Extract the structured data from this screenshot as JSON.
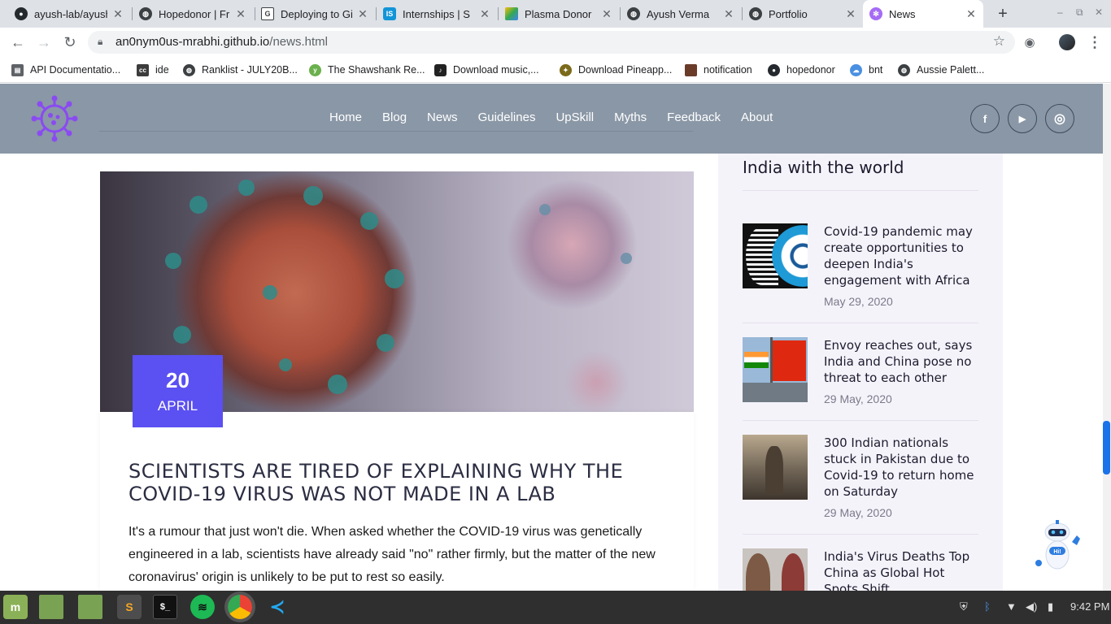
{
  "browser": {
    "tabs": [
      {
        "title": "ayush-lab/ayush",
        "icon": "github-icon",
        "active": false
      },
      {
        "title": "Hopedonor | Fr",
        "icon": "globe-icon",
        "active": false
      },
      {
        "title": "Deploying to Gi",
        "icon": "doc-icon",
        "active": false
      },
      {
        "title": "Internships | S",
        "icon": "internshala-icon",
        "active": false
      },
      {
        "title": "Plasma Donor",
        "icon": "drive-icon",
        "active": false
      },
      {
        "title": "Ayush Verma",
        "icon": "globe-icon",
        "active": false
      },
      {
        "title": "Portfolio",
        "icon": "globe-icon",
        "active": false
      },
      {
        "title": "News",
        "icon": "virus-icon",
        "active": true
      }
    ],
    "url_host": "an0nym0us-mrabhi.github.io",
    "url_path": "/news.html",
    "bookmarks": [
      {
        "label": "API Documentatio...",
        "icon": "doc-icon"
      },
      {
        "label": "ide",
        "icon": "cc-icon"
      },
      {
        "label": "Ranklist - JULY20B...",
        "icon": "globe-icon"
      },
      {
        "label": "The Shawshank Re...",
        "icon": "yts-icon"
      },
      {
        "label": "Download music,...",
        "icon": "music-icon"
      },
      {
        "label": "Download Pineapp...",
        "icon": "pineapple-icon"
      },
      {
        "label": "notification",
        "icon": "image-icon"
      },
      {
        "label": "hopedonor",
        "icon": "github-icon"
      },
      {
        "label": "bnt",
        "icon": "cloud-icon"
      },
      {
        "label": "Aussie Palett...",
        "icon": "globe-icon"
      }
    ]
  },
  "site": {
    "menu": [
      "Home",
      "Blog",
      "News",
      "Guidelines",
      "UpSkill",
      "Myths",
      "Feedback",
      "About"
    ],
    "social": [
      {
        "icon": "facebook-icon",
        "glyph": "f"
      },
      {
        "icon": "youtube-icon",
        "glyph": "▶"
      },
      {
        "icon": "instagram-icon",
        "glyph": "◎"
      }
    ]
  },
  "article": {
    "day": "20",
    "month": "APRIL",
    "title": "SCIENTISTS ARE TIRED OF EXPLAINING WHY THE COVID-19 VIRUS WAS NOT MADE IN A LAB",
    "excerpt": "It's a rumour that just won't die. When asked whether the COVID-19 virus was genetically engineered in a lab, scientists have already said \"no\" rather firmly, but the matter of the new coronavirus' origin is unlikely to be put to rest so easily."
  },
  "sidebar": {
    "heading": "India with the world",
    "items": [
      {
        "title": "Covid-19 pandemic may create opportunities to deepen India's engagement with Africa",
        "date": "May 29, 2020"
      },
      {
        "title": "Envoy reaches out, says India and China pose no threat to each other",
        "date": "29 May, 2020"
      },
      {
        "title": "300 Indian nationals stuck in Pakistan due to Covid-19 to return home on Saturday",
        "date": "29 May, 2020"
      },
      {
        "title": "India's Virus Deaths Top China as Global Hot Spots Shift",
        "date": ""
      }
    ]
  },
  "chatbot": {
    "label": "Hi!"
  },
  "taskbar": {
    "time": "9:42 PM"
  },
  "colors": {
    "nav_bg": "#8a97a6",
    "date_box": "#5b50f2",
    "sidebar_bg": "#f5f3fa",
    "scroll_thumb": "#1a73e8"
  }
}
